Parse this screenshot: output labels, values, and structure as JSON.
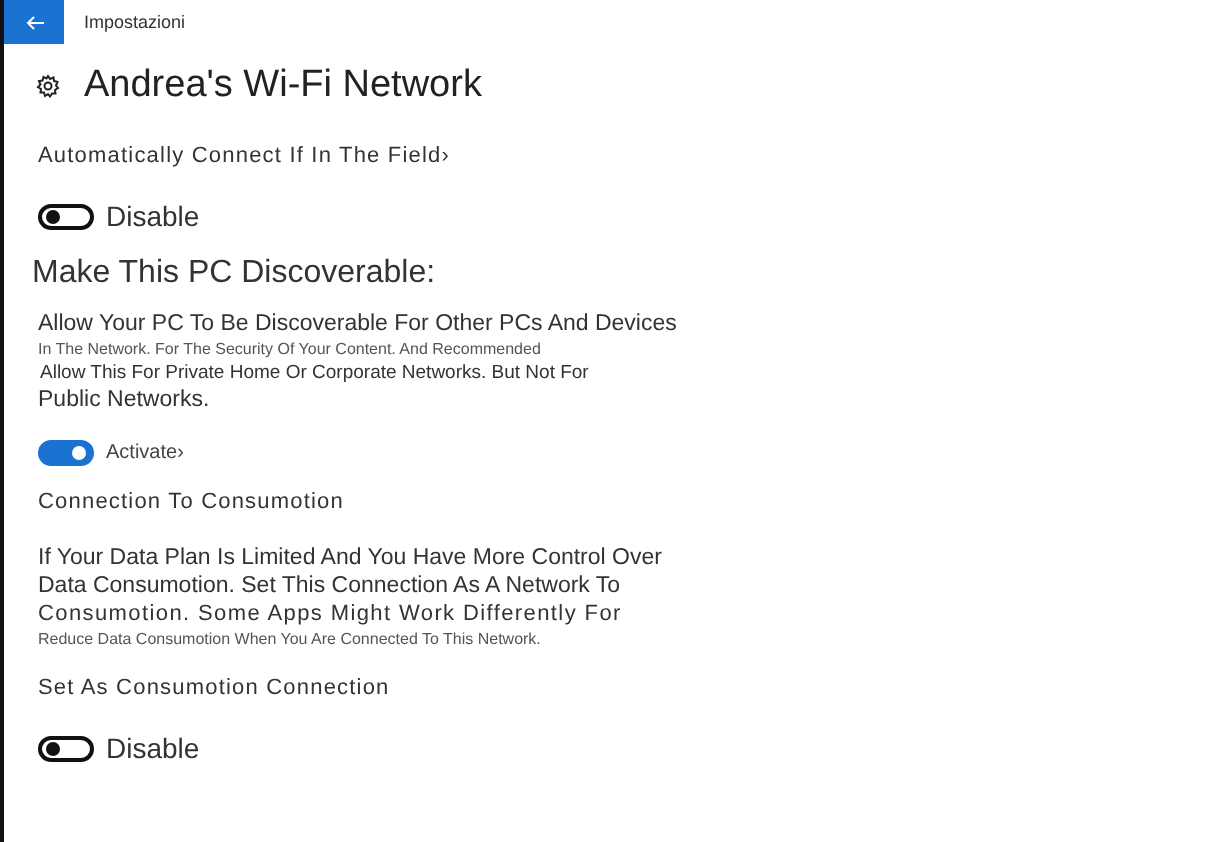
{
  "window": {
    "title": "Impostazioni"
  },
  "page_title": "Andrea's Wi-Fi Network",
  "sections": [
    {
      "heading": {
        "text": "Automatically Connect If In The Field›",
        "kind": "label"
      },
      "toggle": {
        "on": false,
        "label": "Disable",
        "kind": "large"
      }
    },
    {
      "heading": {
        "text": "Make This PC Discoverable:",
        "kind": "title"
      },
      "lines": [
        {
          "text": "Allow Your PC To Be Discoverable For Other PCs And Devices",
          "kind": "normal"
        },
        {
          "text": "In The Network. For The Security Of Your Content. And Recommended",
          "kind": "tiny"
        },
        {
          "text": "Allow This For Private Home Or Corporate Networks. But Not For",
          "kind": "small"
        },
        {
          "text": "Public Networks.",
          "kind": "normal"
        }
      ],
      "toggle": {
        "on": true,
        "label": "Activate›",
        "kind": "small"
      }
    },
    {
      "heading": {
        "text": "Connection To Consumotion",
        "kind": "label"
      },
      "lines": [
        {
          "text": "If Your Data Plan Is Limited And You Have More Control Over",
          "kind": "normal"
        },
        {
          "text": "Data Consumotion. Set This Connection As A Network To",
          "kind": "normal"
        },
        {
          "text": "Consumotion. Some Apps Might Work Differently For",
          "kind": "wide"
        },
        {
          "text": "Reduce Data Consumotion When You Are Connected To This Network.",
          "kind": "tiny"
        }
      ]
    },
    {
      "heading": {
        "text": "Set As Consumotion Connection",
        "kind": "label"
      },
      "toggle": {
        "on": false,
        "label": "Disable",
        "kind": "large"
      }
    }
  ]
}
